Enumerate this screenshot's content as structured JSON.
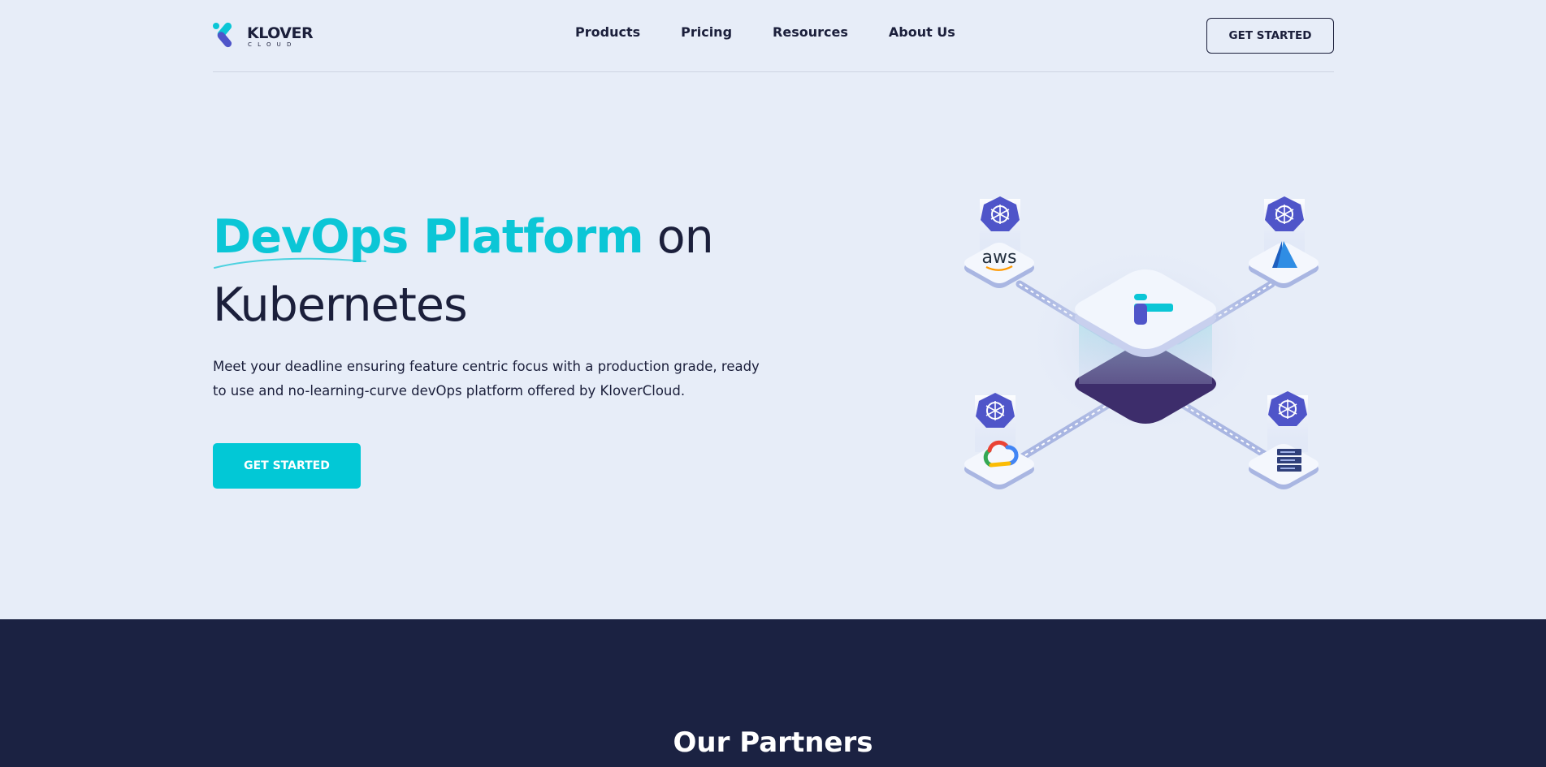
{
  "brand": {
    "name": "KLOVER",
    "sub": "CLOUD",
    "colors": {
      "teal": "#0bc6d6",
      "navy": "#1b1f3b",
      "indigo": "#4f55c9",
      "dark_section": "#1b2242",
      "background": "#e7edf8"
    }
  },
  "nav": {
    "items": [
      {
        "label": "Products"
      },
      {
        "label": "Pricing"
      },
      {
        "label": "Resources"
      },
      {
        "label": "About Us"
      }
    ],
    "cta_label": "GET STARTED"
  },
  "hero": {
    "title_accent": "DevOps Platform",
    "title_rest": " on",
    "title_line2": "Kubernetes",
    "description": "Meet your deadline ensuring feature centric focus with a production grade, ready to use and no-learning-curve devOps platform offered by KloverCloud.",
    "cta_label": "GET STARTED"
  },
  "illustration": {
    "nodes": [
      {
        "icon": "kubernetes-icon",
        "provider": "aws",
        "label": "aws"
      },
      {
        "icon": "kubernetes-icon",
        "provider": "azure-icon"
      },
      {
        "icon": "kubernetes-icon",
        "provider": "google-cloud-icon"
      },
      {
        "icon": "kubernetes-icon",
        "provider": "server-rack-icon"
      }
    ],
    "center": "klovercloud-hub-icon"
  },
  "partners": {
    "title": "Our Partners"
  }
}
